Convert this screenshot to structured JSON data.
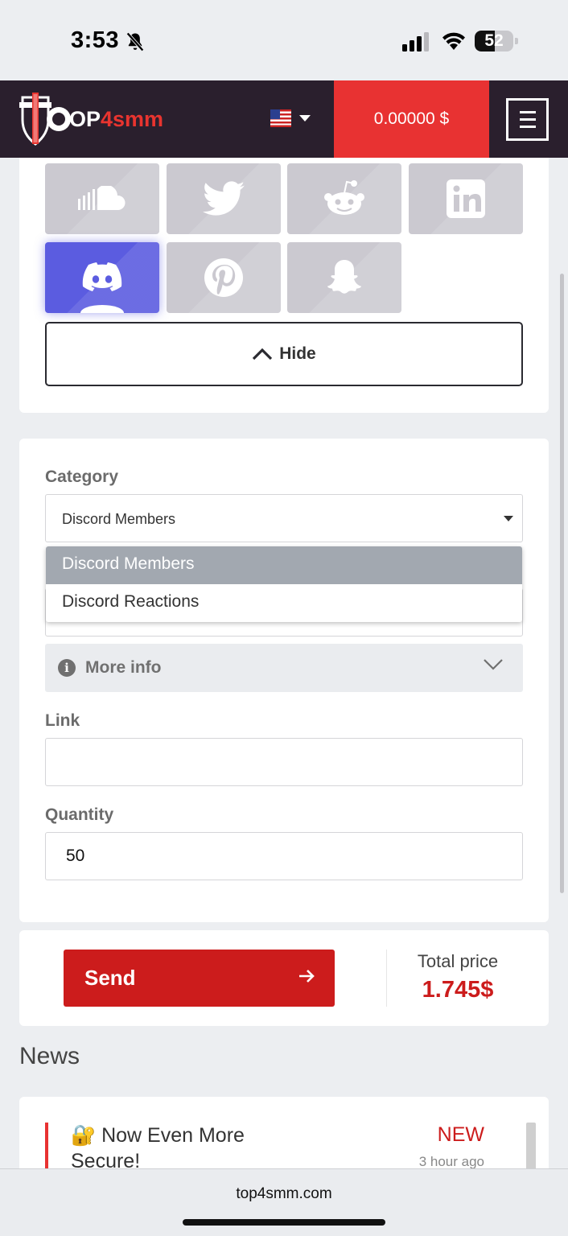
{
  "status_bar": {
    "time": "3:53",
    "battery_level": "52",
    "battery_fraction": 0.52
  },
  "header": {
    "logo_prefix": "T",
    "logo_white": "OP",
    "logo_red": "4smm",
    "balance": "0.00000 $",
    "language_icon": "us-flag-icon"
  },
  "platforms": {
    "icons": [
      "soundcloud-icon",
      "twitter-icon",
      "reddit-icon",
      "linkedin-icon",
      "discord-icon",
      "pinterest-icon",
      "snapchat-icon"
    ],
    "selected": "discord-icon",
    "hide_label": "Hide"
  },
  "form": {
    "category_label": "Category",
    "category_value": "Discord Members",
    "category_options": [
      "Discord Members",
      "Discord Reactions"
    ],
    "more_info_label": "More info",
    "link_label": "Link",
    "link_value": "",
    "quantity_label": "Quantity",
    "quantity_value": "50"
  },
  "order": {
    "send_label": "Send",
    "total_label": "Total price",
    "total_value": "1.745$"
  },
  "news": {
    "title": "News",
    "items": [
      {
        "emoji": "🔐",
        "text": "Now Even More Secure!",
        "badge": "NEW",
        "time": "3 hour ago"
      }
    ]
  },
  "browser": {
    "url": "top4smm.com"
  },
  "colors": {
    "brand_red": "#e83232",
    "send_red": "#cc1c1c",
    "header_bg": "#2a1f2d",
    "discord": "#5b5ce0"
  }
}
